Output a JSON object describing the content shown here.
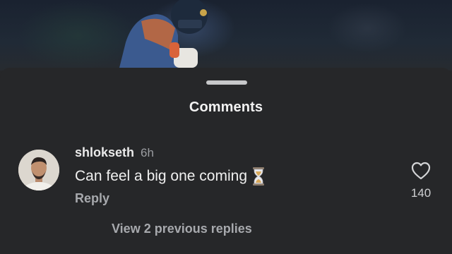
{
  "sheet": {
    "title": "Comments"
  },
  "comment": {
    "username": "shlokseth",
    "time": "6h",
    "text": "Can feel a big one coming",
    "emoji_icon": "hourglass-icon",
    "reply_label": "Reply",
    "like_icon": "heart-icon",
    "like_count": "140",
    "view_replies_label": "View 2 previous replies"
  },
  "colors": {
    "background": "#262729",
    "primary_text": "#f0f0f0",
    "secondary_text": "#a7a9ad",
    "grabber": "#c7c8ca"
  }
}
